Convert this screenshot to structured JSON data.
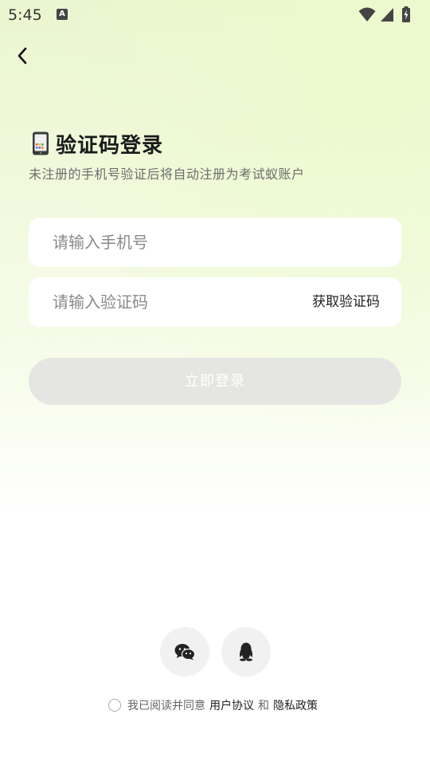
{
  "status_bar": {
    "time": "5:45",
    "notification_glyph": "A"
  },
  "header": {
    "back_icon": "chevron-left-icon"
  },
  "title": {
    "icon": "phone-icon",
    "text": "验证码登录",
    "subtitle": "未注册的手机号验证后将自动注册为考试蚁账户"
  },
  "form": {
    "phone_placeholder": "请输入手机号",
    "phone_value": "",
    "code_placeholder": "请输入验证码",
    "code_value": "",
    "get_code_label": "获取验证码",
    "submit_label": "立即登录"
  },
  "social_login": [
    {
      "name": "wechat",
      "icon": "wechat-icon"
    },
    {
      "name": "qq",
      "icon": "qq-icon"
    }
  ],
  "agreement": {
    "checked": false,
    "prefix": "我已阅读并同意",
    "user_agreement": "用户协议",
    "conjunction": "和",
    "privacy_policy": "隐私政策"
  },
  "colors": {
    "background_top": "#eaf6cf",
    "input_bg": "#ffffff",
    "button_disabled": "#e5e6e3",
    "social_bg": "#f1f1f1"
  }
}
